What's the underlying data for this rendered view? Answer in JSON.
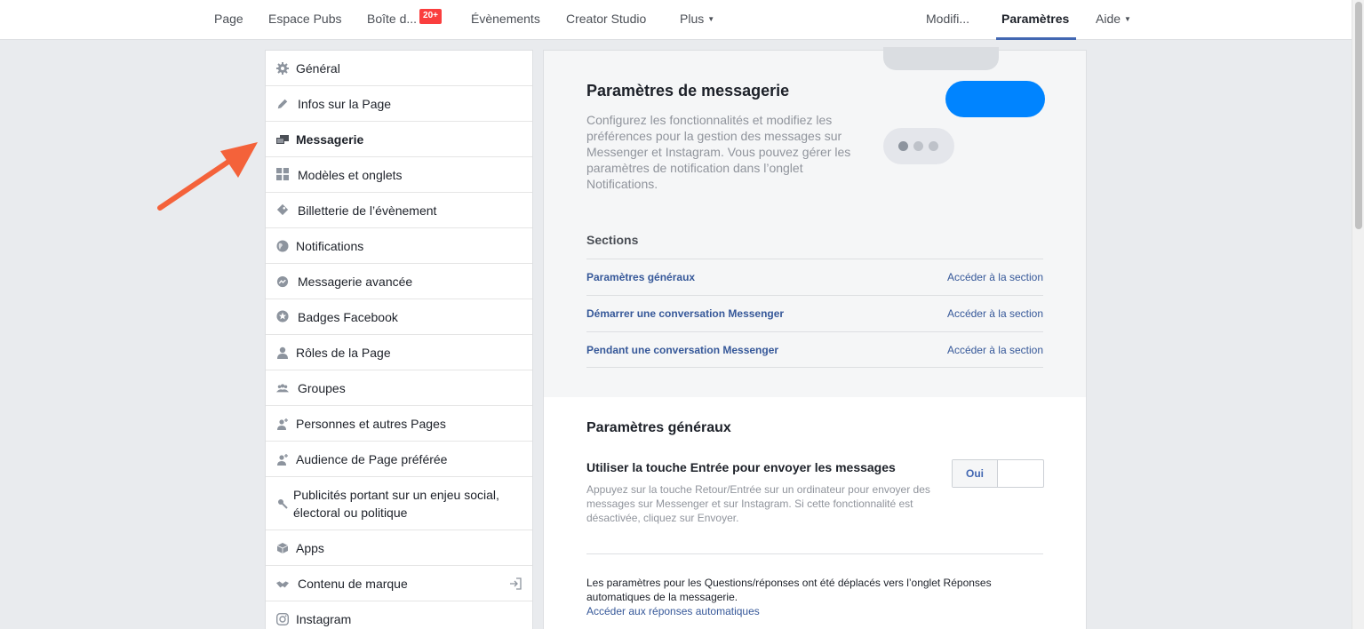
{
  "topnav": {
    "page": "Page",
    "ads": "Espace Pubs",
    "inbox": "Boîte d...",
    "inbox_badge": "20+",
    "events": "Évènements",
    "creator_studio": "Creator Studio",
    "more": "Plus",
    "edit": "Modifi...",
    "settings": "Paramètres",
    "help": "Aide"
  },
  "sidebar": {
    "items": [
      {
        "label": "Général",
        "icon": "gear-icon"
      },
      {
        "label": "Infos sur la Page",
        "icon": "pencil-icon"
      },
      {
        "label": "Messagerie",
        "icon": "chat-bubbles-icon"
      },
      {
        "label": "Modèles et onglets",
        "icon": "grid-icon"
      },
      {
        "label": "Billetterie de l’évènement",
        "icon": "ticket-icon"
      },
      {
        "label": "Notifications",
        "icon": "globe-icon"
      },
      {
        "label": "Messagerie avancée",
        "icon": "messenger-icon"
      },
      {
        "label": "Badges Facebook",
        "icon": "star-badge-icon"
      },
      {
        "label": "Rôles de la Page",
        "icon": "person-icon"
      },
      {
        "label": "Groupes",
        "icon": "group-icon"
      },
      {
        "label": "Personnes et autres Pages",
        "icon": "person-plus-icon"
      },
      {
        "label": "Audience de Page préférée",
        "icon": "person-plus-icon"
      },
      {
        "label": "Publicités portant sur un enjeu social,",
        "label2": "électoral ou politique",
        "icon": "wrench-icon"
      },
      {
        "label": "Apps",
        "icon": "cube-icon"
      },
      {
        "label": "Contenu de marque",
        "icon": "handshake-icon"
      },
      {
        "label": "Instagram",
        "icon": "instagram-icon"
      }
    ]
  },
  "main": {
    "title": "Paramètres de messagerie",
    "description": "Configurez les fonctionnalités et modifiez les préférences pour la gestion des messages sur Messenger et Instagram. Vous pouvez gérer les paramètres de notification dans l’onglet Notifications.",
    "sections_label": "Sections",
    "sections": [
      {
        "name": "Paramètres généraux",
        "link": "Accéder à la section"
      },
      {
        "name": "Démarrer une conversation Messenger",
        "link": "Accéder à la section"
      },
      {
        "name": "Pendant une conversation Messenger",
        "link": "Accéder à la section"
      }
    ],
    "general_title": "Paramètres généraux",
    "enter_setting_title": "Utiliser la touche Entrée pour envoyer les messages",
    "enter_setting_desc": "Appuyez sur la touche Retour/Entrée sur un ordinateur pour envoyer des messages sur Messenger et sur Instagram. Si cette fonctionnalité est désactivée, cliquez sur Envoyer.",
    "toggle_on_label": "Oui",
    "note": "Les paramètres pour les Questions/réponses ont été déplacés vers l’onglet Réponses automatiques de la messagerie.",
    "note_link": "Accéder aux réponses automatiques"
  },
  "colors": {
    "accent": "#4267b2",
    "link": "#365899",
    "messenger_blue": "#0084ff",
    "badge_red": "#fa3e3e",
    "arrow": "#f4623a"
  }
}
